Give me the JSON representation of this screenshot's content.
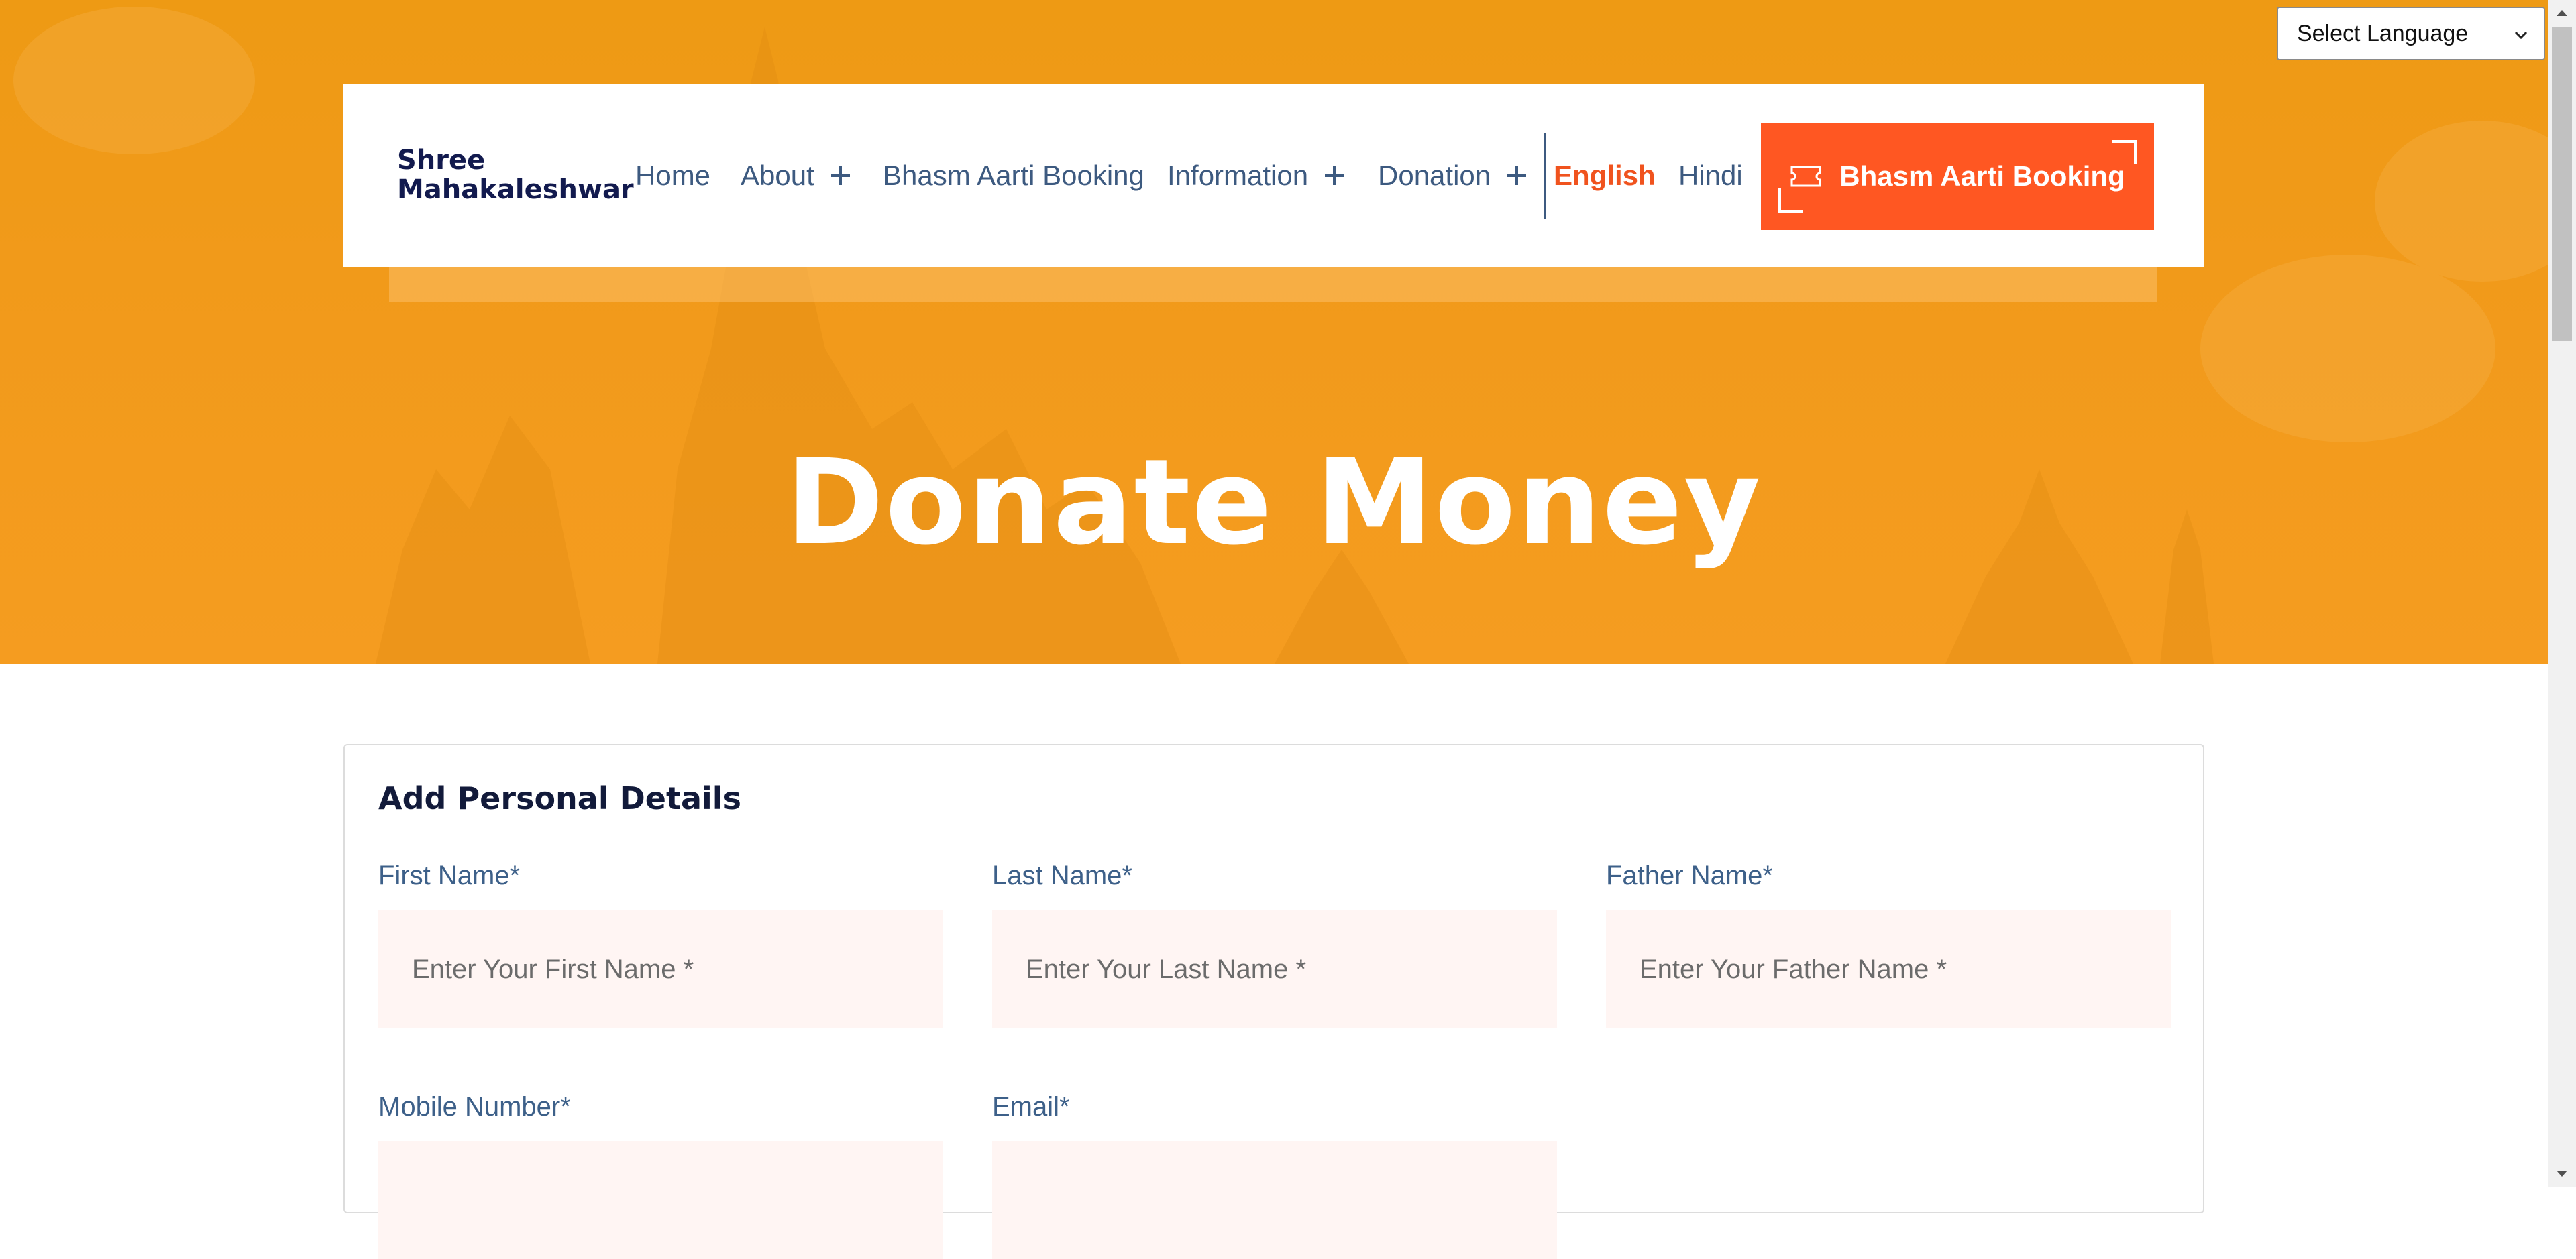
{
  "language_select": {
    "selected": "Select Language"
  },
  "header": {
    "logo_line1": "Shree",
    "logo_line2": "Mahakaleshwar",
    "nav": {
      "home": "Home",
      "about": "About",
      "bhasm_aarti_booking": "Bhasm Aarti Booking",
      "information": "Information",
      "donation": "Donation"
    },
    "lang_english": "English",
    "lang_hindi": "Hindi",
    "cta_label": "Bhasm Aarti Booking"
  },
  "hero": {
    "title": "Donate Money"
  },
  "form": {
    "heading": "Add Personal Details",
    "first_name": {
      "label": "First Name*",
      "placeholder": "Enter Your First Name *"
    },
    "last_name": {
      "label": "Last Name*",
      "placeholder": "Enter Your Last Name *"
    },
    "father_name": {
      "label": "Father Name*",
      "placeholder": "Enter Your Father Name *"
    },
    "mobile": {
      "label": "Mobile Number*",
      "placeholder": ""
    },
    "email": {
      "label": "Email*",
      "placeholder": ""
    }
  },
  "colors": {
    "hero_orange": "#f19a1a",
    "accent": "#ff5722",
    "nav_text": "#3d5a80",
    "input_bg": "#fff5f3"
  }
}
